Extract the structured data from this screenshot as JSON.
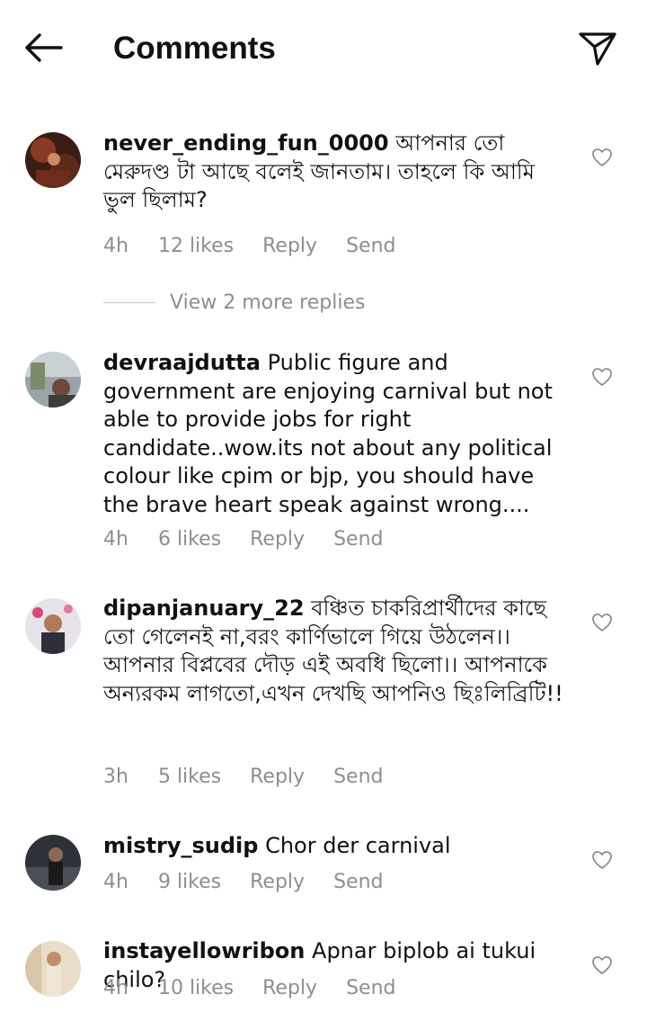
{
  "header": {
    "title": "Comments"
  },
  "comments": [
    {
      "username": "never_ending_fun_0000",
      "text": "আপনার তো মেরুদণ্ড টা আছে বলেই জানতাম। তাহলে কি আমি ভুল ছিলাম?",
      "time": "4h",
      "likes": "12 likes",
      "reply": "Reply",
      "send": "Send"
    },
    {
      "username": "devraajdutta",
      "text": "Public figure and government are enjoying carnival but not able to provide jobs for right candidate..wow.its not about any political colour like cpim or bjp, you should have the brave heart speak against wrong....",
      "time": "4h",
      "likes": "6 likes",
      "reply": "Reply",
      "send": "Send"
    },
    {
      "username": "dipanjanuary_22",
      "text": "বঞ্চিত চাকরিপ্রার্থীদের কাছে তো গেলেনই না,বরং কার্ণিভালে গিয়ে উঠলেন।। আপনার বিপ্লবের দৌড় এই অবধি ছিলো।। আপনাকে অন্যরকম লাগতো,এখন দেখছি আপনিও ছিঃলিব্রিটি!!",
      "time": "3h",
      "likes": "5 likes",
      "reply": "Reply",
      "send": "Send"
    },
    {
      "username": "mistry_sudip",
      "text": "Chor der carnival",
      "time": "4h",
      "likes": "9 likes",
      "reply": "Reply",
      "send": "Send"
    },
    {
      "username": "instayellowribon",
      "text": "Apnar biplob ai tukui chilo?",
      "time": "4h",
      "likes": "10 likes",
      "reply": "Reply",
      "send": "Send"
    }
  ],
  "view_replies": {
    "label": "View 2 more replies"
  },
  "icons": {
    "back": "arrow-left-icon",
    "share": "paper-plane-icon",
    "like": "heart-outline-icon"
  },
  "colors": {
    "text": "#111111",
    "muted": "#8e8e8e",
    "background": "#ffffff"
  }
}
